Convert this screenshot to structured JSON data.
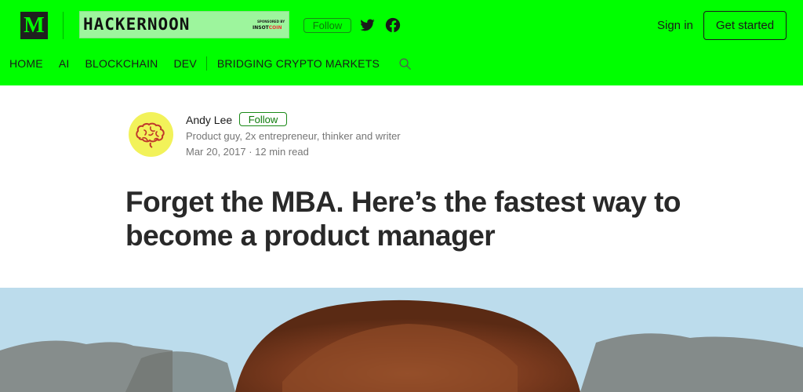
{
  "header": {
    "logo_letter": "M",
    "publication_name": "HACKERNOON",
    "sponsor_label": "SPONSORED BY",
    "sponsor_name_primary": "INSOT",
    "sponsor_name_accent": "COIN",
    "follow_label": "Follow",
    "signin_label": "Sign in",
    "get_started_label": "Get started",
    "nav": [
      "HOME",
      "AI",
      "BLOCKCHAIN",
      "DEV",
      "BRIDGING CRYPTO MARKETS"
    ]
  },
  "author": {
    "name": "Andy Lee",
    "follow_label": "Follow",
    "bio": "Product guy, 2x entrepreneur, thinker and writer",
    "meta": "Mar 20, 2017 · 12 min read"
  },
  "article": {
    "title": "Forget the MBA. Here’s the fastest way to become a product manager"
  },
  "icons": {
    "search": "search-icon",
    "twitter": "twitter-icon",
    "facebook": "facebook-icon",
    "avatar": "brain-icon"
  },
  "colors": {
    "header_bg": "#00ff00",
    "follow_green": "#1a8917",
    "avatar_bg": "#f2f25a",
    "title_text": "#292929",
    "meta_text": "#757575"
  }
}
